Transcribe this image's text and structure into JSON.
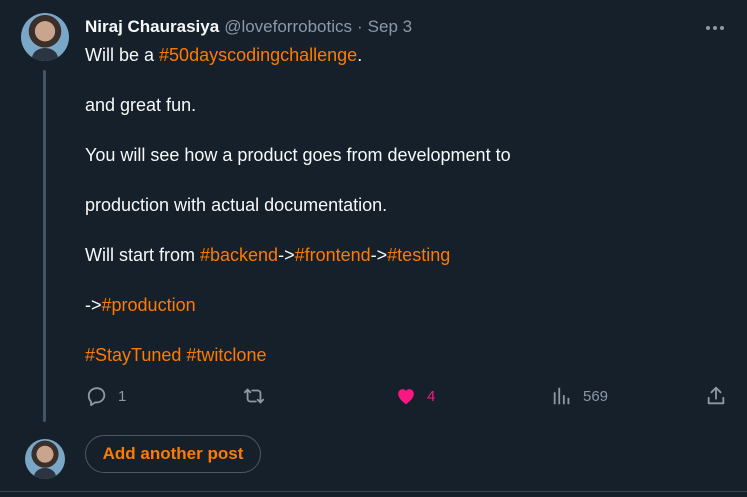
{
  "post": {
    "author_name": "Niraj Chaurasiya",
    "author_handle": "@loveforrobotics",
    "separator": "·",
    "date": "Sep 3",
    "lines": {
      "l1_pre": "Will be a ",
      "l1_tag": "#50dayscodingchallenge",
      "l1_post": ".",
      "l2": "and great fun.",
      "l3": "You will see how a product goes from development to",
      "l4": "production with actual documentation.",
      "l5_pre": "Will start from ",
      "l5_tag1": "#backend",
      "l5_arrow1": "->",
      "l5_tag2": "#frontend",
      "l5_arrow2": "->",
      "l5_tag3": "#testing",
      "l6_arrow": "->",
      "l6_tag": "#production",
      "l7_tag1": "#StayTuned",
      "l7_space": " ",
      "l7_tag2": "#twitclone"
    }
  },
  "actions": {
    "reply_count": "1",
    "repost_count": "",
    "like_count": "4",
    "views_count": "569"
  },
  "icons": {
    "reply": "speech-bubble-icon",
    "repost": "repost-arrows-icon",
    "like": "heart-icon",
    "views": "bar-chart-icon",
    "share": "share-upload-icon",
    "more": "more-dots-icon"
  },
  "colors": {
    "background": "#15202b",
    "accent": "#ff7a00",
    "like": "#f91880",
    "muted": "#8b98a5"
  },
  "reply_composer": {
    "button_label": "Add another post"
  }
}
